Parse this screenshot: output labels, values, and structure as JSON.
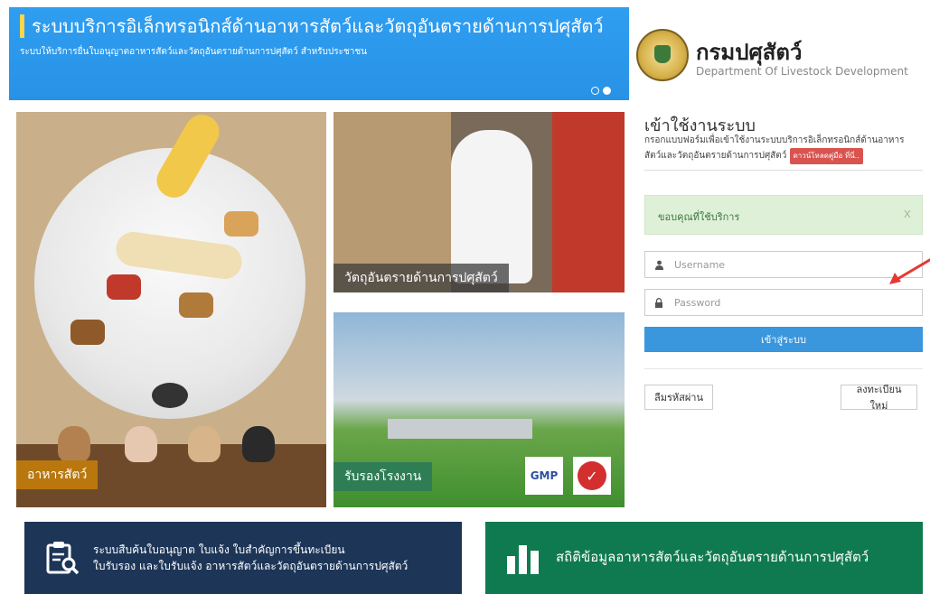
{
  "banner": {
    "title": "ระบบบริการอิเล็กทรอนิกส์ด้านอาหารสัตว์และวัตถุอันตรายด้านการปศุสัตว์",
    "subtitle": "ระบบให้บริการยื่นใบอนุญาตอาหารสัตว์และวัตถุอันตรายด้านการปศุสัตว์ สำหรับประชาชน",
    "slides": [
      false,
      true
    ]
  },
  "org": {
    "name": "กรมปศุสัตว์",
    "name_en": "Department Of Livestock Development"
  },
  "tiles": {
    "feed_label": "อาหารสัตว์",
    "hazard_label": "วัตถุอันตรายด้านการปศุสัตว์",
    "factory_label": "รับรองโรงงาน",
    "gmp_label": "GMP",
    "haccp_label": "✓"
  },
  "login": {
    "title": "เข้าใช้งานระบบ",
    "description": "กรอกแบบฟอร์มเพื่อเข้าใช้งานระบบบริการอิเล็กทรอนิกส์ด้านอาหารสัตว์และวัตถุอันตรายด้านการปศุสัตว์",
    "manual_badge": "ดาวน์โหลดคู่มือ ที่นี่..",
    "alert": "ขอบคุณที่ใช้บริการ",
    "alert_close": "x",
    "username_placeholder": "Username",
    "username_value": "",
    "password_placeholder": "Password",
    "password_value": "",
    "submit_label": "เข้าสู่ระบบ",
    "forgot_label": "ลืมรหัสผ่าน",
    "register_label": "ลงทะเบียนใหม่"
  },
  "bottom": {
    "search_line1": "ระบบสืบค้นใบอนุญาต ใบแจ้ง ใบสำคัญการขึ้นทะเบียน",
    "search_line2": "ใบรับรอง และใบรับแจ้ง อาหารสัตว์และวัตถุอันตรายด้านการปศุสัตว์",
    "stats_label": "สถิติข้อมูลอาหารสัตว์และวัตถุอันตรายด้านการปศุสัตว์"
  },
  "colors": {
    "banner": "#2f9ef0",
    "accent_yellow": "#ffd54a",
    "submit": "#3a96dd",
    "alert_bg": "#dff0d8",
    "feed_label": "#b9770e",
    "factory_label": "#2e7d55",
    "search_bar": "#1d3557",
    "stats_bar": "#0f7a4f",
    "annotation_arrow": "#e53935"
  },
  "icons": {
    "username": "user-icon",
    "password": "lock-icon",
    "search_bar": "clipboard-search-icon",
    "stats_bar": "bar-chart-icon"
  }
}
